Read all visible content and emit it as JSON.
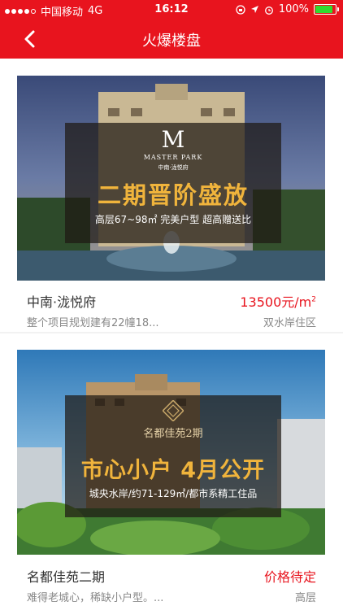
{
  "status": {
    "carrier": "中国移动",
    "network": "4G",
    "time": "16:12",
    "battery": "100%"
  },
  "nav": {
    "title": "火爆楼盘"
  },
  "listings": [
    {
      "logo_letter": "M",
      "logo_en": "MASTER PARK",
      "logo_cn": "中南·泷悦府",
      "headline": "二期晋阶盛放",
      "subline": "高层67~98㎡ 完美户型 超高赠送比",
      "name": "中南·泷悦府",
      "price_text": "13500元/m",
      "price_sup": "2",
      "desc": "整个项目规划建有22幢18...",
      "area": "双水岸住区"
    },
    {
      "logo_cn": "名都佳苑2期",
      "headline": "市心小户 4月公开",
      "subline": "城央水岸/约71-129㎡/都市系精工住品",
      "name": "名都佳苑二期",
      "price_text": "价格待定",
      "desc": "难得老城心，稀缺小户型。...",
      "area": "高层"
    }
  ],
  "colors": {
    "brand_red": "#e8141e",
    "headline_gold": "#f0b43c"
  }
}
